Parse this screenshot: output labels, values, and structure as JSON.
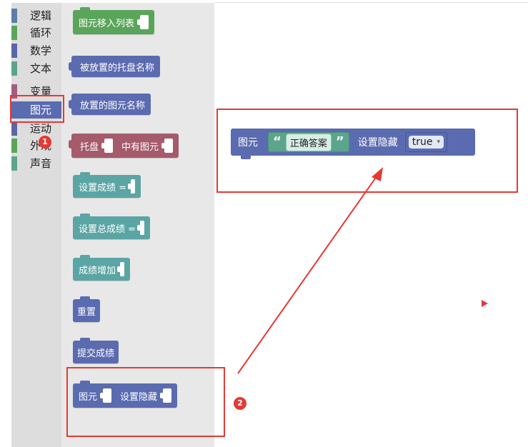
{
  "categories": [
    {
      "label": "逻辑",
      "color": "#5b80a5"
    },
    {
      "label": "循环",
      "color": "#5ba55b"
    },
    {
      "label": "数学",
      "color": "#5b67a5"
    },
    {
      "label": "文本",
      "color": "#5ba58c"
    },
    {
      "label": "变量",
      "color": "#a55b80"
    },
    {
      "label": "图元",
      "color": "#5b6bb0",
      "selected": true
    },
    {
      "label": "运动",
      "color": "#5b67a5"
    },
    {
      "label": "外观",
      "color": "#5ba55b"
    },
    {
      "label": "声音",
      "color": "#5ba58c"
    }
  ],
  "flyout_blocks": {
    "move_to_list": "图元移入列表",
    "placed_tray_name": "被放置的托盘名称",
    "placed_sprite_name": "放置的图元名称",
    "tray_label": "托盘",
    "tray_has_sprite": "中有图元",
    "set_score": "设置成绩 =",
    "set_total_score": "设置总成绩 =",
    "add_score": "成绩增加",
    "reset": "重置",
    "submit_score": "提交成绩",
    "sprite_label": "图元",
    "set_hidden": "设置隐藏"
  },
  "workspace_block": {
    "sprite_label": "图元",
    "open_quote": "“",
    "string_value": "正确答案",
    "close_quote": "”",
    "set_hidden": "设置隐藏",
    "dropdown_value": "true",
    "dropdown_arrow": "▾"
  },
  "annotations": {
    "badge1": "1",
    "badge2": "2"
  },
  "colors": {
    "sprite_block": "#5b6bb0",
    "list_block": "#5ba55b",
    "tray_block": "#a55b6b",
    "score_block": "#5ba5a5",
    "annotation_red": "#e53935"
  }
}
